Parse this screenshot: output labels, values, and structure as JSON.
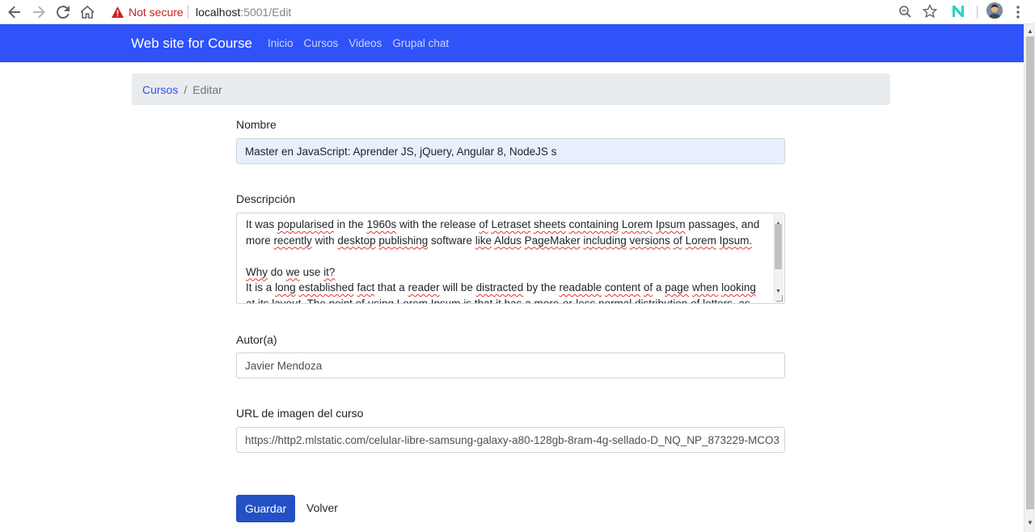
{
  "browser": {
    "security_label": "Not secure",
    "url_host": "localhost",
    "url_path": ":5001/Edit",
    "icons": [
      "back-arrow-icon",
      "forward-arrow-icon",
      "reload-icon",
      "home-icon",
      "warning-icon",
      "zoom-icon",
      "star-icon",
      "extension-icon",
      "profile-avatar",
      "menu-icon"
    ]
  },
  "navbar": {
    "brand": "Web site for Course",
    "links": [
      "Inicio",
      "Cursos",
      "Videos",
      "Grupal chat"
    ],
    "background": "#2f52f9"
  },
  "breadcrumb": {
    "link": "Cursos",
    "separator": "/",
    "active": "Editar"
  },
  "form": {
    "nombre_label": "Nombre",
    "nombre_value": "Master en JavaScript: Aprender JS, jQuery, Angular 8, NodeJS s",
    "descripcion_label": "Descripción",
    "descripcion_lines": [
      " It was popularised in the 1960s with the release of Letraset sheets containing Lorem Ipsum passages, and",
      "more recently with desktop publishing software like Aldus PageMaker including versions of Lorem Ipsum.",
      "",
      "Why do we use it?",
      "It is a long established fact that a reader will be distracted by the readable content of a page when looking",
      "at its layout. The point of using Lorem Ipsum is that it has a more-or-less normal distribution of letters, as"
    ],
    "autor_label": "Autor(a)",
    "autor_value": "Javier Mendoza",
    "url_label": "URL de imagen del curso",
    "url_value": "https://http2.mlstatic.com/celular-libre-samsung-galaxy-a80-128gb-8ram-4g-sellado-D_NQ_NP_873229-MCO3",
    "save_button": "Guardar",
    "back_link": "Volver"
  }
}
